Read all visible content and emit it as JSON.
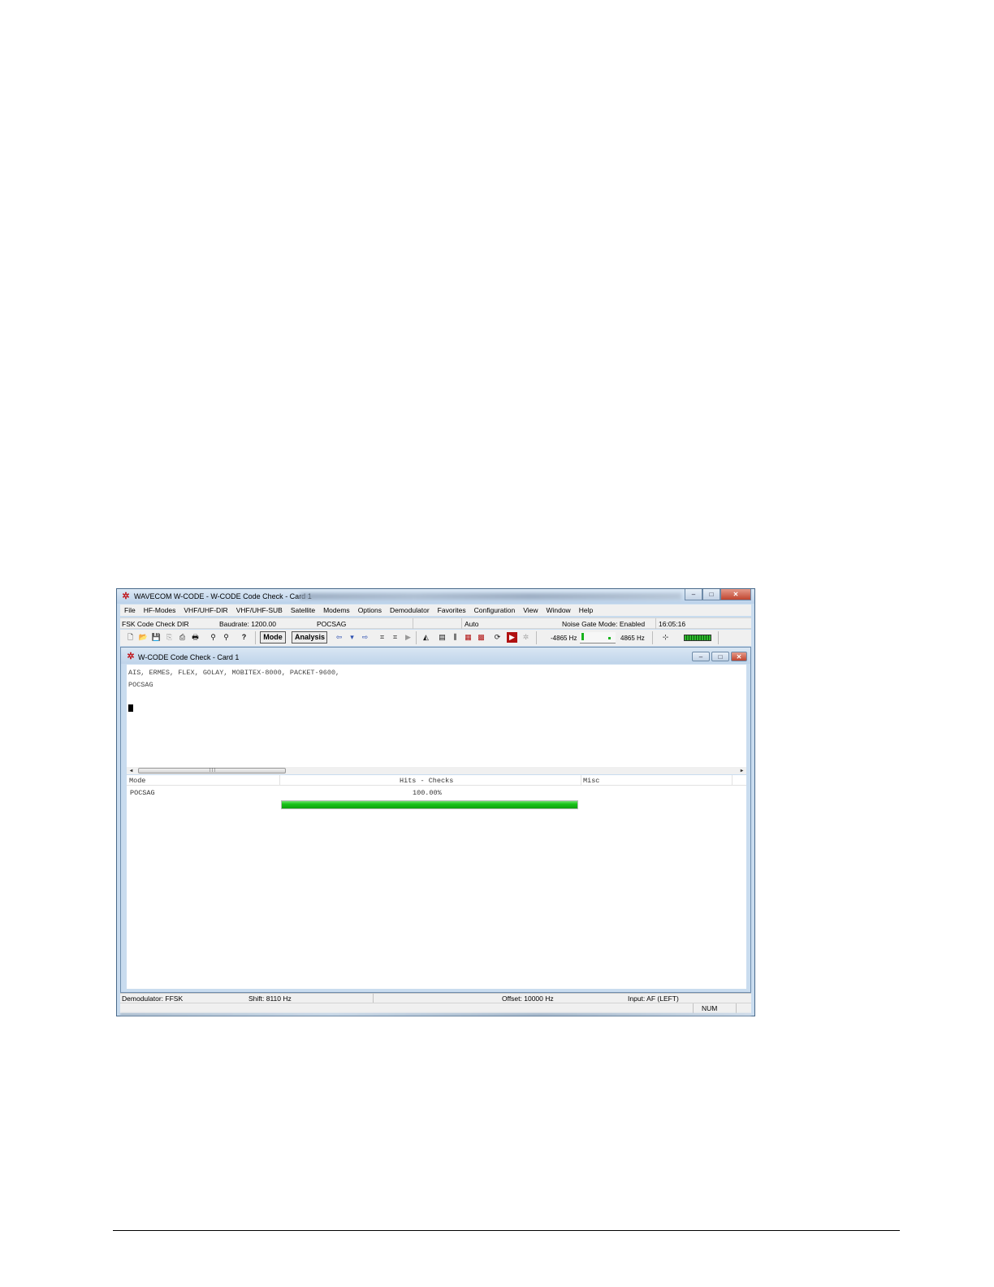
{
  "app": {
    "title": "WAVECOM W-CODE - W-CODE Code Check - Card 1",
    "window_buttons": {
      "minimize": "–",
      "maximize": "□",
      "close": "✕"
    }
  },
  "menu": [
    "File",
    "HF-Modes",
    "VHF/UHF-DIR",
    "VHF/UHF-SUB",
    "Satellite",
    "Modems",
    "Options",
    "Demodulator",
    "Favorites",
    "Configuration",
    "View",
    "Window",
    "Help"
  ],
  "infobar": {
    "mode": "FSK Code Check DIR",
    "baudrate": "Baudrate: 1200.00",
    "detected": "POCSAG",
    "auto": "Auto",
    "noise_gate": "Noise Gate Mode: Enabled",
    "time": "16:05:16"
  },
  "toolbar": {
    "mode_button": "Mode",
    "analysis_button": "Analysis",
    "freq_left": "-4865 Hz",
    "freq_right": "4865 Hz"
  },
  "child": {
    "title": "W-CODE Code Check  - Card 1",
    "output_lines": [
      "AIS, ERMES, FLEX, GOLAY, MOBITEX-8000, PACKET-9600,",
      "POCSAG"
    ]
  },
  "results": {
    "headers": {
      "mode": "Mode",
      "hits": "Hits - Checks",
      "misc": "Misc"
    },
    "rows": [
      {
        "mode": "POCSAG",
        "percent_label": "100.00%",
        "progress": 1.0
      }
    ]
  },
  "status": {
    "demodulator": "Demodulator: FFSK",
    "shift": "Shift: 8110 Hz",
    "offset": "Offset: 10000 Hz",
    "input": "Input: AF (LEFT)",
    "num": "NUM"
  },
  "colors": {
    "accent": "#c0161c",
    "progress": "#19c319",
    "window_frame": "#c9dcef"
  }
}
